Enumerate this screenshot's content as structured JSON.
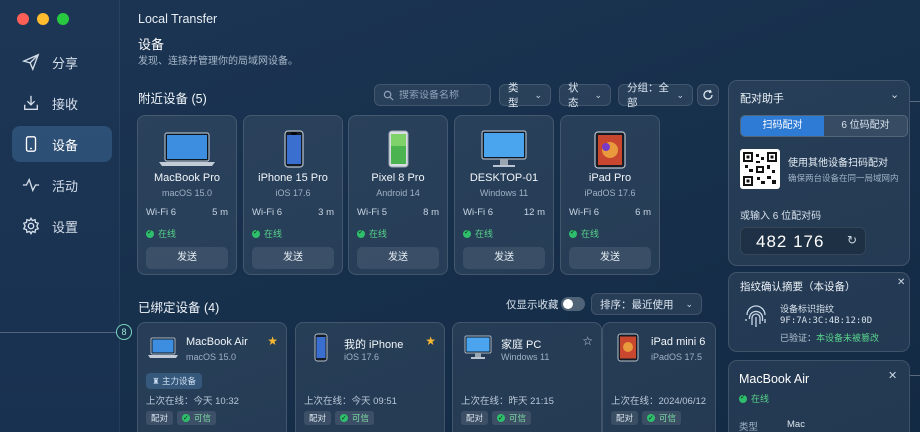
{
  "app": {
    "title": "Local Transfer"
  },
  "sidebar": {
    "items": [
      {
        "label": "分享",
        "icon": "send-icon"
      },
      {
        "label": "接收",
        "icon": "receive-icon"
      },
      {
        "label": "设备",
        "icon": "device-icon",
        "active": true
      },
      {
        "label": "活动",
        "icon": "activity-icon"
      },
      {
        "label": "设置",
        "icon": "gear-icon"
      }
    ],
    "badge": "8"
  },
  "header": {
    "title": "设备",
    "subtitle": "发现、连接并管理你的局域网设备。"
  },
  "nearby": {
    "title": "附近设备 (5)",
    "search_placeholder": "搜索设备名称",
    "filter_type": "类型",
    "filter_status": "状态",
    "group": "分组：全部",
    "devices": [
      {
        "name": "MacBook Pro",
        "os": "macOS 15.0",
        "net": "Wi-Fi 6",
        "dist": "5 m",
        "status": "在线",
        "action": "发送",
        "kind": "laptop"
      },
      {
        "name": "iPhone 15 Pro",
        "os": "iOS 17.6",
        "net": "Wi-Fi 6",
        "dist": "3 m",
        "status": "在线",
        "action": "发送",
        "kind": "phone"
      },
      {
        "name": "Pixel 8 Pro",
        "os": "Android 14",
        "net": "Wi-Fi 5",
        "dist": "8 m",
        "status": "在线",
        "action": "发送",
        "kind": "android"
      },
      {
        "name": "DESKTOP-01",
        "os": "Windows 11",
        "net": "Wi-Fi 6",
        "dist": "12 m",
        "status": "在线",
        "action": "发送",
        "kind": "desktop"
      },
      {
        "name": "iPad Pro",
        "os": "iPadOS 17.6",
        "net": "Wi-Fi 6",
        "dist": "6 m",
        "status": "在线",
        "action": "发送",
        "kind": "tablet"
      }
    ]
  },
  "bound": {
    "title": "已绑定设备 (4)",
    "toggle_label": "仅显示收藏",
    "sort": "排序：最近使用",
    "devices": [
      {
        "name": "MacBook Air",
        "os": "macOS 15.0",
        "tag": "主力设备",
        "last": "上次在线：今天 10:32",
        "chip1": "配对",
        "chip2": "可信",
        "starred": true
      },
      {
        "name": "我的 iPhone",
        "os": "iOS 17.6",
        "tag": "",
        "last": "上次在线：今天 09:51",
        "chip1": "配对",
        "chip2": "可信",
        "starred": true
      },
      {
        "name": "家庭 PC",
        "os": "Windows 11",
        "tag": "",
        "last": "上次在线：昨天 21:15",
        "chip1": "配对",
        "chip2": "可信",
        "starred": false
      },
      {
        "name": "iPad mini 6",
        "os": "iPadOS 17.5",
        "tag": "",
        "last": "上次在线：2024/06/12",
        "chip1": "配对",
        "chip2": "可信",
        "starred": false
      }
    ]
  },
  "pairing": {
    "title": "配对助手",
    "tab_scan": "扫码配对",
    "tab_code": "6 位码配对",
    "scan_title": "使用其他设备扫码配对",
    "scan_sub": "确保两台设备在同一局域网内",
    "code_label": "或输入 6 位配对码",
    "code": "482 176"
  },
  "fingerprint": {
    "title": "指纹确认摘要（本设备）",
    "label": "设备标识指纹",
    "value": "9F:7A:3C:4B:12:0D",
    "verified_prefix": "已验证：",
    "verified_text": "本设备未被篡改"
  },
  "detail": {
    "title": "MacBook Air",
    "status": "在线",
    "row_label": "类型",
    "row_value": "Mac"
  },
  "colors": {
    "accent": "#2e7bd6",
    "online": "#2fbf6c",
    "star": "#f5b731"
  }
}
